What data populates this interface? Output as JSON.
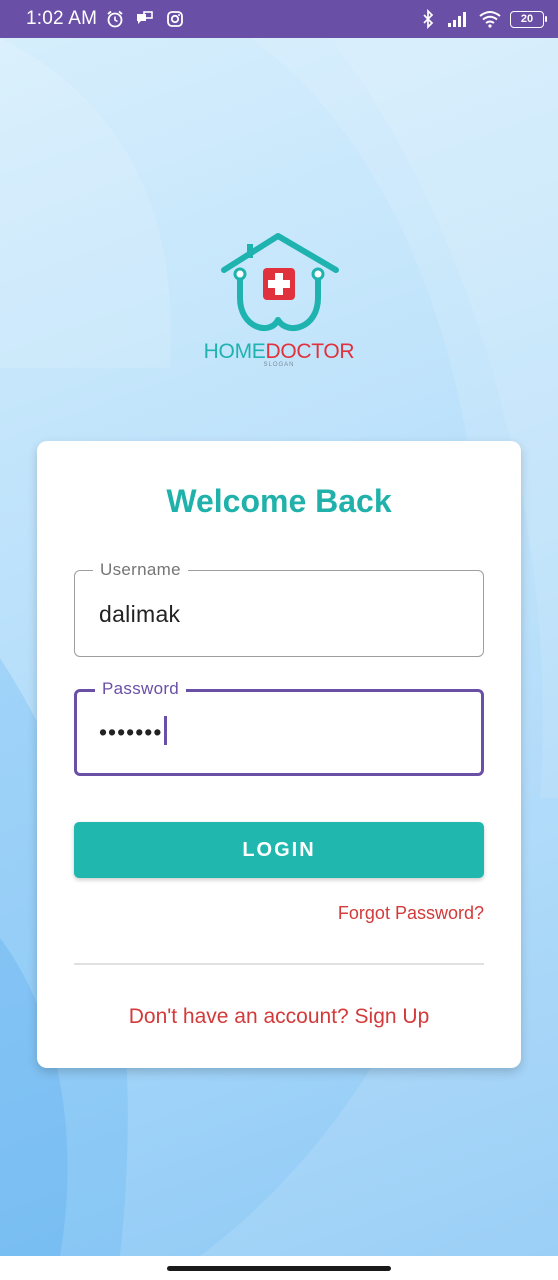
{
  "status_bar": {
    "time": "1:02 AM",
    "battery_level": "20",
    "left_icons": [
      "alarm-icon",
      "message-icon",
      "instagram-icon"
    ],
    "right_icons": [
      "bluetooth-icon",
      "signal-icon",
      "wifi-icon",
      "battery-icon"
    ]
  },
  "logo": {
    "brand_home": "HOME",
    "brand_doctor": "DOCTOR",
    "slogan": "SLOGAN",
    "colors": {
      "teal": "#1fb3b0",
      "red": "#e0313c"
    }
  },
  "login_card": {
    "title": "Welcome Back",
    "username": {
      "label": "Username",
      "value": "dalimak"
    },
    "password": {
      "label": "Password",
      "value": "•••••••"
    },
    "login_button": "LOGIN",
    "forgot_password": "Forgot Password?",
    "signup_prompt": "Don't have an account? Sign Up"
  },
  "colors": {
    "accent": "#20b2aa",
    "primary": "#6a4fa6",
    "link": "#d33a3a"
  }
}
